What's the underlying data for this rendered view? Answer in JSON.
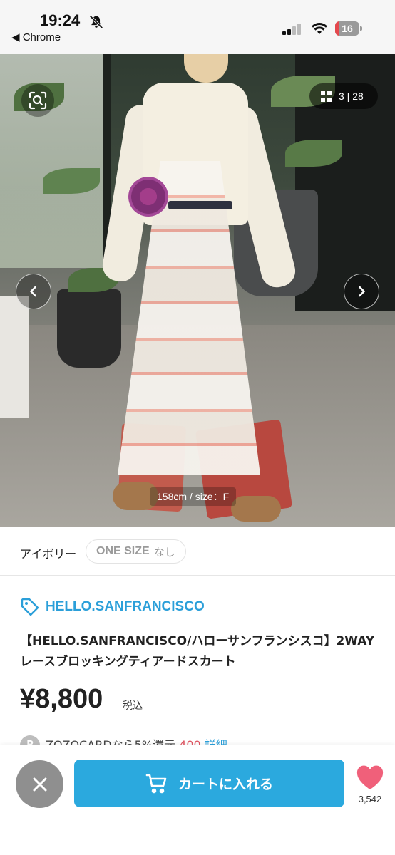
{
  "status_bar": {
    "time": "19:24",
    "back_app": "◀ Chrome",
    "battery": "16",
    "icons": [
      "bell-slash-icon",
      "signal-icon",
      "wifi-icon",
      "battery-icon"
    ]
  },
  "gallery": {
    "counter": "3 | 28",
    "current_index": 3,
    "total": 28,
    "caption": "158cm / size：F",
    "icons": [
      "scan-icon",
      "grid-icon",
      "chevron-left-icon",
      "chevron-right-icon"
    ]
  },
  "variant": {
    "color": "アイボリー",
    "size_name": "ONE SIZE",
    "size_stock": "なし"
  },
  "product": {
    "brand": "HELLO.SANFRANCISCO",
    "title": "【HELLO.SANFRANCISCO/ハローサンフランシスコ】2WAY レースブロッキングティアードスカート",
    "price": "¥8,800",
    "tax_label": "税込"
  },
  "promo": {
    "icon_label": "P",
    "text": "ZOZOCARDなら5%還元",
    "amount": "400",
    "link": "詳細"
  },
  "actions": {
    "cart_label": "カートに入れる",
    "favorite_count": "3,542"
  },
  "colors": {
    "accent": "#2ba9de",
    "brand": "#2b9fd9",
    "heart": "#f0607a",
    "close": "#8f8f8f"
  }
}
